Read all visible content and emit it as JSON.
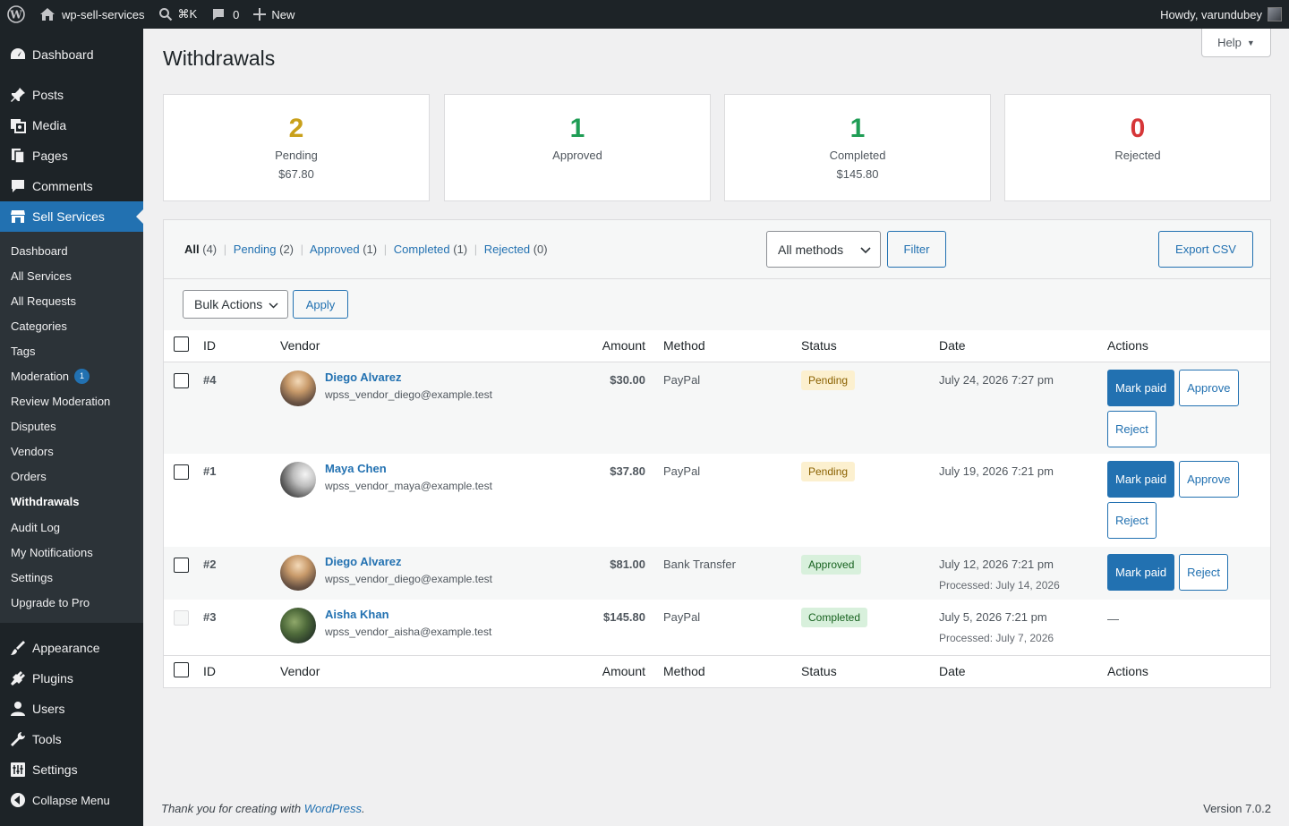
{
  "adminbar": {
    "site_name": "wp-sell-services",
    "search_shortcut": "⌘K",
    "comments_count": "0",
    "new_label": "New",
    "howdy": "Howdy, varundubey"
  },
  "sidebar": {
    "top_items": [
      {
        "label": "Dashboard",
        "icon": "dashboard-icon"
      },
      {
        "label": "Posts",
        "icon": "pin-icon"
      },
      {
        "label": "Media",
        "icon": "media-icon"
      },
      {
        "label": "Pages",
        "icon": "pages-icon"
      },
      {
        "label": "Comments",
        "icon": "comment-icon"
      },
      {
        "label": "Sell Services",
        "icon": "store-icon"
      }
    ],
    "submenu": [
      {
        "label": "Dashboard"
      },
      {
        "label": "All Services"
      },
      {
        "label": "All Requests"
      },
      {
        "label": "Categories"
      },
      {
        "label": "Tags"
      },
      {
        "label": "Moderation",
        "badge": "1"
      },
      {
        "label": "Review Moderation"
      },
      {
        "label": "Disputes"
      },
      {
        "label": "Vendors"
      },
      {
        "label": "Orders"
      },
      {
        "label": "Withdrawals",
        "current": true
      },
      {
        "label": "Audit Log"
      },
      {
        "label": "My Notifications"
      },
      {
        "label": "Settings"
      },
      {
        "label": "Upgrade to Pro"
      }
    ],
    "bottom_items": [
      {
        "label": "Appearance",
        "icon": "brush-icon"
      },
      {
        "label": "Plugins",
        "icon": "plugin-icon"
      },
      {
        "label": "Users",
        "icon": "user-icon"
      },
      {
        "label": "Tools",
        "icon": "wrench-icon"
      },
      {
        "label": "Settings",
        "icon": "settings-icon"
      },
      {
        "label": "Collapse Menu",
        "icon": "collapse-icon"
      }
    ]
  },
  "header": {
    "title": "Withdrawals",
    "help_label": "Help"
  },
  "stats": [
    {
      "count": "2",
      "label": "Pending",
      "amount": "$67.80",
      "color": "#c9a01a"
    },
    {
      "count": "1",
      "label": "Approved",
      "amount": "",
      "color": "#1f9d55"
    },
    {
      "count": "1",
      "label": "Completed",
      "amount": "$145.80",
      "color": "#1f9d55"
    },
    {
      "count": "0",
      "label": "Rejected",
      "amount": "",
      "color": "#d63638"
    }
  ],
  "filters": {
    "views": [
      {
        "label": "All",
        "count": "(4)"
      },
      {
        "label": "Pending",
        "count": "(2)"
      },
      {
        "label": "Approved",
        "count": "(1)"
      },
      {
        "label": "Completed",
        "count": "(1)"
      },
      {
        "label": "Rejected",
        "count": "(0)"
      }
    ],
    "method_select": "All methods",
    "filter_button": "Filter",
    "export_button": "Export CSV",
    "bulk_select": "Bulk Actions",
    "apply_button": "Apply"
  },
  "table": {
    "columns": [
      "ID",
      "Vendor",
      "Amount",
      "Method",
      "Status",
      "Date",
      "Actions"
    ],
    "rows": [
      {
        "id": "#4",
        "vendor": "Diego Alvarez",
        "email": "wpss_vendor_diego@example.test",
        "amount": "$30.00",
        "method": "PayPal",
        "status": "Pending",
        "date": "July 24, 2026 7:27 pm",
        "processed": "",
        "actions": [
          "Mark paid",
          "Approve",
          "Reject"
        ]
      },
      {
        "id": "#1",
        "vendor": "Maya Chen",
        "email": "wpss_vendor_maya@example.test",
        "amount": "$37.80",
        "method": "PayPal",
        "status": "Pending",
        "date": "July 19, 2026 7:21 pm",
        "processed": "",
        "actions": [
          "Mark paid",
          "Approve",
          "Reject"
        ]
      },
      {
        "id": "#2",
        "vendor": "Diego Alvarez",
        "email": "wpss_vendor_diego@example.test",
        "amount": "$81.00",
        "method": "Bank Transfer",
        "status": "Approved",
        "date": "July 12, 2026 7:21 pm",
        "processed": "Processed: July 14, 2026",
        "actions": [
          "Mark paid",
          "Reject"
        ]
      },
      {
        "id": "#3",
        "vendor": "Aisha Khan",
        "email": "wpss_vendor_aisha@example.test",
        "amount": "$145.80",
        "method": "PayPal",
        "status": "Completed",
        "date": "July 5, 2026 7:21 pm",
        "processed": "Processed: July 7, 2026",
        "actions_placeholder": "—"
      }
    ]
  },
  "footer": {
    "thanks_prefix": "Thank you for creating with ",
    "wordpress_link": "WordPress",
    "thanks_suffix": ".",
    "version": "Version 7.0.2"
  }
}
